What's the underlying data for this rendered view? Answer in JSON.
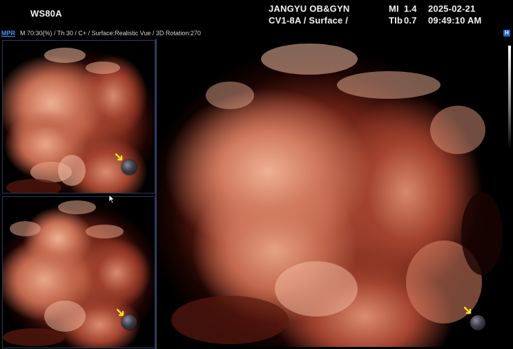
{
  "header": {
    "model": "WS80A",
    "hospital": "JANGYU OB&GYN",
    "probe_info": "CV1-8A / Surface /",
    "mi_label": "MI",
    "mi_value": "1.4",
    "tib_label": "TIb",
    "tib_value": "0.7",
    "date": "2025-02-21",
    "time": "09:49:10 AM"
  },
  "status": {
    "mode_button": "MPR",
    "params": "M 70:30(%) / Th 30 / C+ / Surface:Realistic Vue / 3D Rotation:270",
    "badge": "H"
  },
  "colors": {
    "accent": "#3f9bff",
    "skin_light": "#e8a184",
    "skin_mid": "#c7654a",
    "skin_dark": "#6a1c12",
    "background": "#000000"
  },
  "icons": {
    "marker": "sphere-marker-icon",
    "arrow": "yellow-arrow-icon",
    "cursor": "mouse-pointer-icon"
  }
}
